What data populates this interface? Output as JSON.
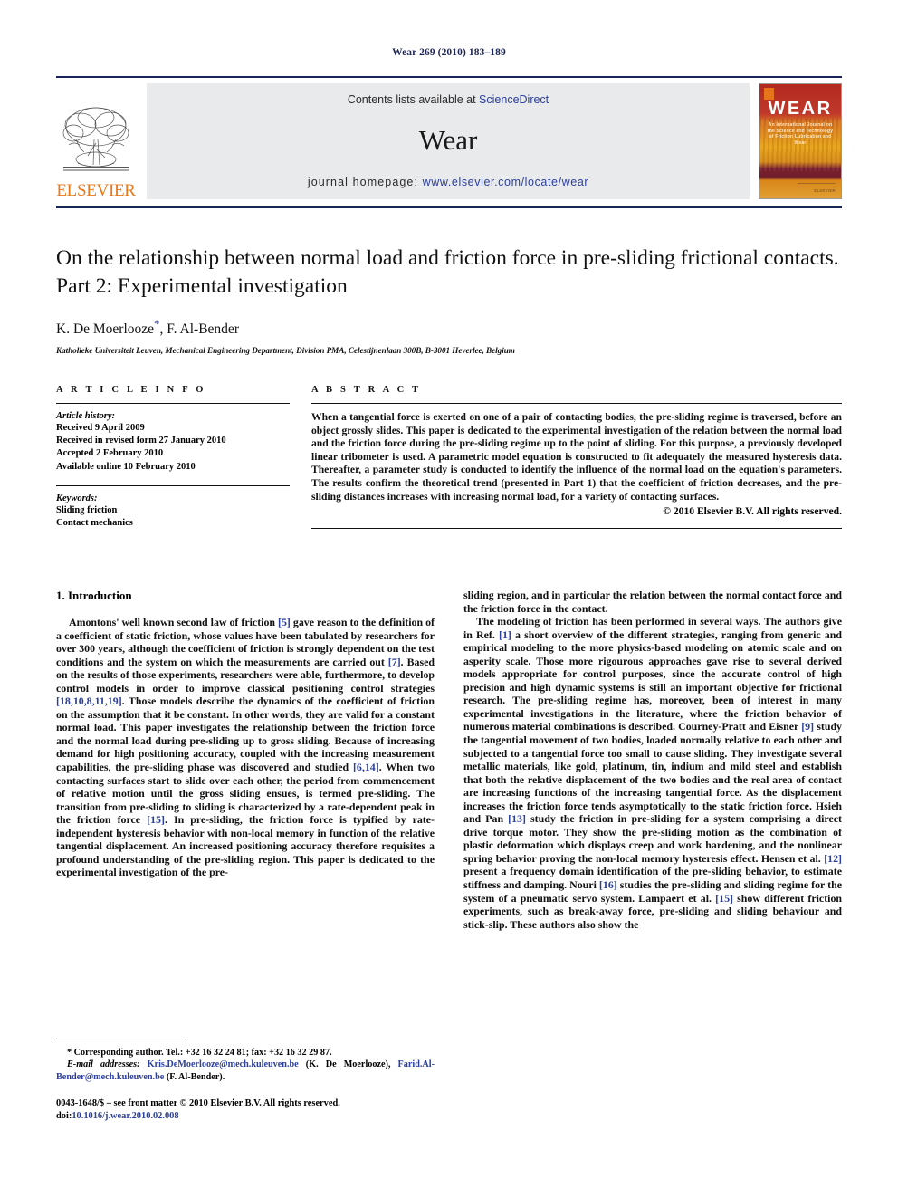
{
  "running_head": "Wear 269 (2010) 183–189",
  "masthead": {
    "contents_prefix": "Contents lists available at ",
    "sciencedirect": "ScienceDirect",
    "journal_title": "Wear",
    "homepage_label": "journal homepage: ",
    "homepage_url": "www.elsevier.com/locate/wear",
    "publisher_wordmark": "ELSEVIER",
    "cover": {
      "title": "WEAR",
      "subtitle": "An International Journal on the Science and Technology of Friction Lubrication and Wear",
      "footer": "ELSEVIER"
    },
    "accent_blue": "#1b2456",
    "link_blue": "#2b3f9e",
    "elsevier_orange": "#e8791b",
    "banner_gray": "#e9eaec"
  },
  "article": {
    "title": "On the relationship between normal load and friction force in pre-sliding frictional contacts. Part 2: Experimental investigation",
    "authors": "K. De Moerlooze",
    "authors_rest": ", F. Al-Bender",
    "corresponding_marker": "*",
    "affiliation": "Katholieke Universiteit Leuven, Mechanical Engineering Department, Division PMA, Celestijnenlaan 300B, B-3001 Heverlee, Belgium"
  },
  "info": {
    "heading": "A R T I C L E    I N F O",
    "history_label": "Article history:",
    "history": [
      "Received 9 April 2009",
      "Received in revised form 27 January 2010",
      "Accepted 2 February 2010",
      "Available online 10 February 2010"
    ],
    "keywords_label": "Keywords:",
    "keywords": [
      "Sliding friction",
      "Contact mechanics"
    ]
  },
  "abstract": {
    "heading": "A B S T R A C T",
    "text": "When a tangential force is exerted on one of a pair of contacting bodies, the pre-sliding regime is traversed, before an object grossly slides. This paper is dedicated to the experimental investigation of the relation between the normal load and the friction force during the pre-sliding regime up to the point of sliding. For this purpose, a previously developed linear tribometer is used. A parametric model equation is constructed to fit adequately the measured hysteresis data. Thereafter, a parameter study is conducted to identify the influence of the normal load on the equation's parameters. The results confirm the theoretical trend (presented in Part 1) that the coefficient of friction decreases, and the pre-sliding distances increases with increasing normal load, for a variety of contacting surfaces.",
    "copyright": "© 2010 Elsevier B.V. All rights reserved."
  },
  "body": {
    "section_number_title": "1.  Introduction",
    "left_para1_a": "Amontons' well known second law of friction ",
    "left_para1_ref1": "[5]",
    "left_para1_b": " gave reason to the definition of a coefficient of static friction, whose values have been tabulated by researchers for over 300 years, although the coefficient of friction is strongly dependent on the test conditions and the system on which the measurements are carried out ",
    "left_para1_ref2": "[7]",
    "left_para1_c": ". Based on the results of those experiments, researchers were able, furthermore, to develop control models in order to improve classical positioning control strategies ",
    "left_para1_ref3": "[18,10,8,11,19]",
    "left_para1_d": ". Those models describe the dynamics of the coefficient of friction on the assumption that it be constant. In other words, they are valid for a constant normal load. This paper investigates the relationship between the friction force and the normal load during pre-sliding up to gross sliding. Because of increasing demand for high positioning accuracy, coupled with the increasing measurement capabilities, the pre-sliding phase was discovered and studied ",
    "left_para1_ref4": "[6,14]",
    "left_para1_e": ". When two contacting surfaces start to slide over each other, the period from commencement of relative motion until the gross sliding ensues, is termed pre-sliding. The transition from pre-sliding to sliding is characterized by a rate-dependent peak in the friction force ",
    "left_para1_ref5": "[15]",
    "left_para1_f": ". In pre-sliding, the friction force is typified by rate-independent hysteresis behavior with non-local memory in function of the relative tangential displacement. An increased positioning accuracy therefore requisites a profound understanding of the pre-sliding region. This paper is dedicated to the experimental investigation of the pre-",
    "right_para1_cont": "sliding region, and in particular the relation between the normal contact force and the friction force in the contact.",
    "right_para2_a": "The modeling of friction has been performed in several ways. The authors give in Ref. ",
    "right_para2_ref1": "[1]",
    "right_para2_b": " a short overview of the different strategies, ranging from generic and empirical modeling to the more physics-based modeling on atomic scale and on asperity scale. Those more rigourous approaches gave rise to several derived models appropriate for control purposes, since the accurate control of high precision and high dynamic systems is still an important objective for frictional research. The pre-sliding regime has, moreover, been of interest in many experimental investigations in the literature, where the friction behavior of numerous material combinations is described. Courney-Pratt and Eisner ",
    "right_para2_ref2": "[9]",
    "right_para2_c": " study the tangential movement of two bodies, loaded normally relative to each other and subjected to a tangential force too small to cause sliding. They investigate several metallic materials, like gold, platinum, tin, indium and mild steel and establish that both the relative displacement of the two bodies and the real area of contact are increasing functions of the increasing tangential force. As the displacement increases the friction force tends asymptotically to the static friction force. Hsieh and Pan ",
    "right_para2_ref3": "[13]",
    "right_para2_d": " study the friction in pre-sliding for a system comprising a direct drive torque motor. They show the pre-sliding motion as the combination of plastic deformation which displays creep and work hardening, and the nonlinear spring behavior proving the non-local memory hysteresis effect. Hensen et al. ",
    "right_para2_ref4": "[12]",
    "right_para2_e": " present a frequency domain identification of the pre-sliding behavior, to estimate stiffness and damping. Nouri ",
    "right_para2_ref5": "[16]",
    "right_para2_f": " studies the pre-sliding and sliding regime for the system of a pneumatic servo system. Lampaert et al. ",
    "right_para2_ref6": "[15]",
    "right_para2_g": " show different friction experiments, such as break-away force, pre-sliding and sliding behaviour and stick-slip. These authors also show the"
  },
  "footnote": {
    "star": "*",
    "corresponding": " Corresponding author. Tel.: +32 16 32 24 81; fax: +32 16 32 29 87.",
    "email_label": "E-mail addresses:",
    "email1": "Kris.DeMoerlooze@mech.kuleuven.be",
    "email1_owner": " (K. De Moerlooze),",
    "email2": "Farid.Al-Bender@mech.kuleuven.be",
    "email2_owner": " (F. Al-Bender)."
  },
  "imprint": {
    "issn_line": "0043-1648/$ – see front matter © 2010 Elsevier B.V. All rights reserved.",
    "doi_label": "doi:",
    "doi_value": "10.1016/j.wear.2010.02.008"
  }
}
